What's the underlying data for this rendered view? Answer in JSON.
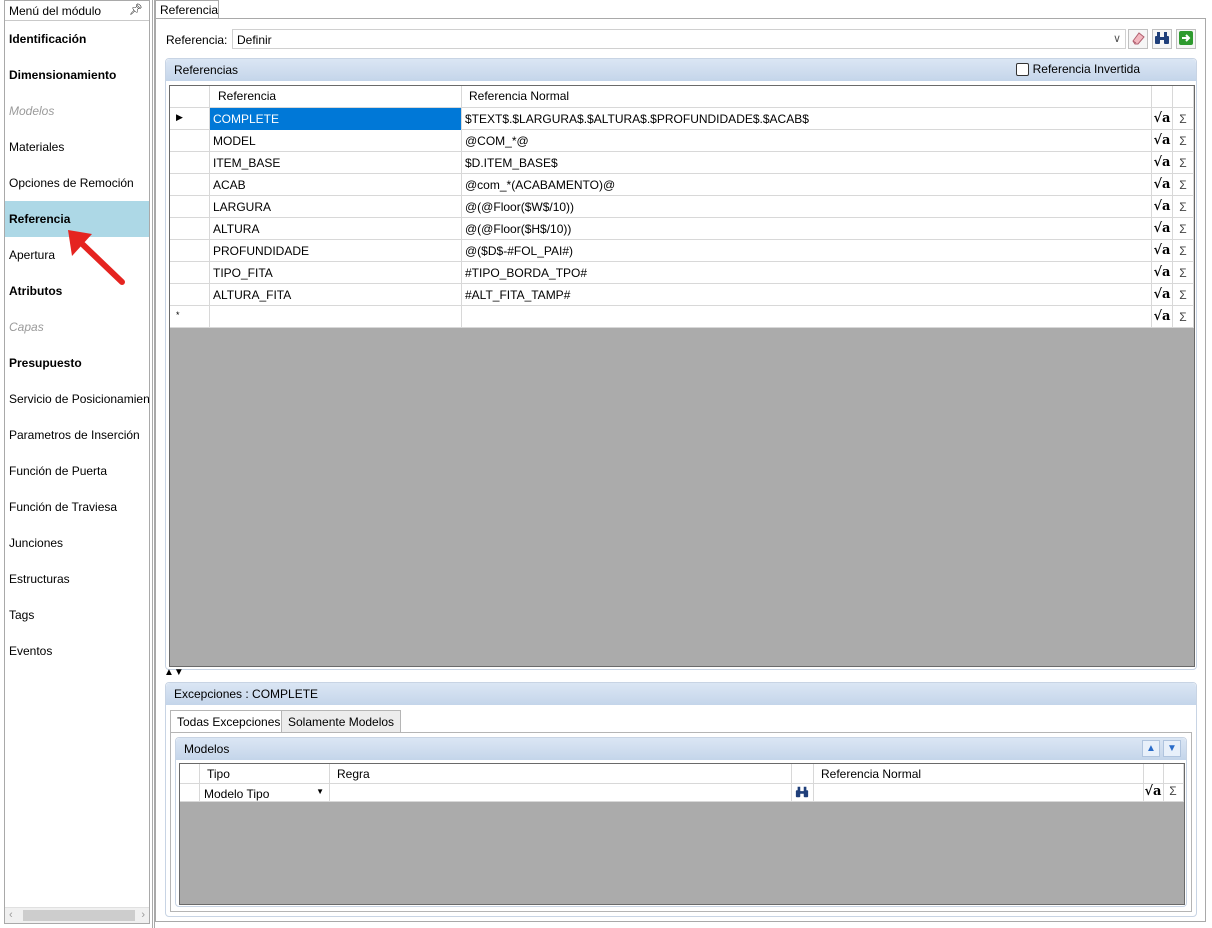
{
  "sidebar": {
    "title": "Menú del módulo",
    "pin_icon": "pin-icon",
    "items": [
      {
        "label": "Identificación",
        "style": "bold"
      },
      {
        "label": "Dimensionamiento",
        "style": "bold"
      },
      {
        "label": "Modelos",
        "style": "disabled"
      },
      {
        "label": "Materiales",
        "style": "normal"
      },
      {
        "label": "Opciones de Remoción",
        "style": "normal"
      },
      {
        "label": "Referencia",
        "style": "selected"
      },
      {
        "label": "Apertura",
        "style": "normal"
      },
      {
        "label": "Atributos",
        "style": "bold"
      },
      {
        "label": "Capas",
        "style": "disabled"
      },
      {
        "label": "Presupuesto",
        "style": "bold"
      },
      {
        "label": "Servicio de Posicionamiento",
        "style": "normal"
      },
      {
        "label": "Parametros de Inserción",
        "style": "normal"
      },
      {
        "label": "Función de Puerta",
        "style": "normal"
      },
      {
        "label": "Función de Traviesa",
        "style": "normal"
      },
      {
        "label": "Junciones",
        "style": "normal"
      },
      {
        "label": "Estructuras",
        "style": "normal"
      },
      {
        "label": "Tags",
        "style": "normal"
      },
      {
        "label": "Eventos",
        "style": "normal"
      }
    ]
  },
  "document_tab": "Referencia",
  "reference_row": {
    "label": "Referencia:",
    "value": "Definir"
  },
  "references_panel": {
    "title": "Referencias",
    "checkbox_label": "Referencia Invertida",
    "columns": [
      "Referencia",
      "Referencia Normal"
    ],
    "rows": [
      {
        "ref": "COMPLETE",
        "normal": "$TEXT$.$LARGURA$.$ALTURA$.$PROFUNDIDADE$.$ACAB$"
      },
      {
        "ref": "MODEL",
        "normal": "@COM_*@"
      },
      {
        "ref": "ITEM_BASE",
        "normal": "$D.ITEM_BASE$"
      },
      {
        "ref": "ACAB",
        "normal": "@com_*(ACABAMENTO)@"
      },
      {
        "ref": "LARGURA",
        "normal": "@(@Floor($W$/10))"
      },
      {
        "ref": "ALTURA",
        "normal": "@(@Floor($H$/10))"
      },
      {
        "ref": "PROFUNDIDADE",
        "normal": "@($D$-#FOL_PAI#)"
      },
      {
        "ref": "TIPO_FITA",
        "normal": "#TIPO_BORDA_TPO#"
      },
      {
        "ref": "ALTURA_FITA",
        "normal": "#ALT_FITA_TAMP#"
      }
    ],
    "new_row_marker": "*",
    "current_row_marker": "▶",
    "formula_icon_text": "√a",
    "sum_icon_text": "Σ"
  },
  "exceptions_panel": {
    "title": "Excepciones : COMPLETE",
    "tabs": [
      "Todas Excepciones",
      "Solamente Modelos"
    ],
    "models_title": "Modelos",
    "columns": [
      "Tipo",
      "Regra",
      "Referencia Normal"
    ],
    "row": {
      "tipo": "Modelo Tipo",
      "regra": "",
      "normal": ""
    }
  },
  "colors": {
    "selection": "#0078d7",
    "sidebar_selected": "#add8e6",
    "empty_grid": "#ababab",
    "annotation_arrow": "#e52420"
  }
}
